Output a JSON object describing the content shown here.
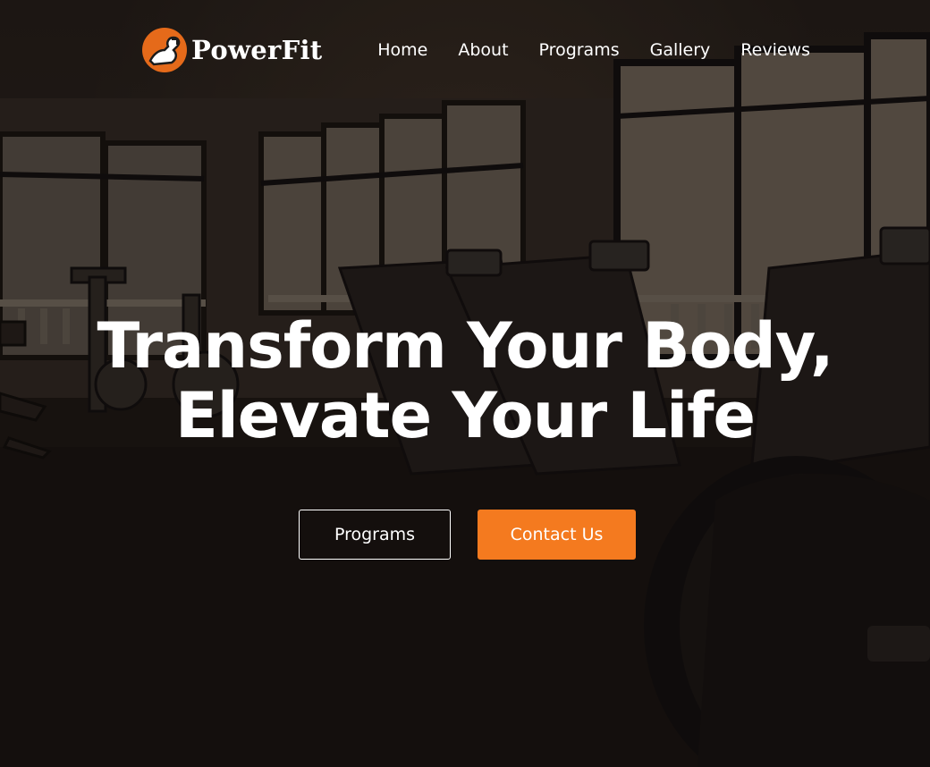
{
  "brand": {
    "name": "PowerFit",
    "accent_color": "#f47a1f",
    "logo_icon": "flexed-arm-icon"
  },
  "nav": {
    "items": [
      {
        "label": "Home"
      },
      {
        "label": "About"
      },
      {
        "label": "Programs"
      },
      {
        "label": "Gallery"
      },
      {
        "label": "Reviews"
      }
    ]
  },
  "hero": {
    "headline_line1": "Transform Your Body,",
    "headline_line2": "Elevate Your Life",
    "background": "gym-interior-treadmills-photo",
    "buttons": {
      "programs_label": "Programs",
      "contact_label": "Contact Us"
    }
  }
}
